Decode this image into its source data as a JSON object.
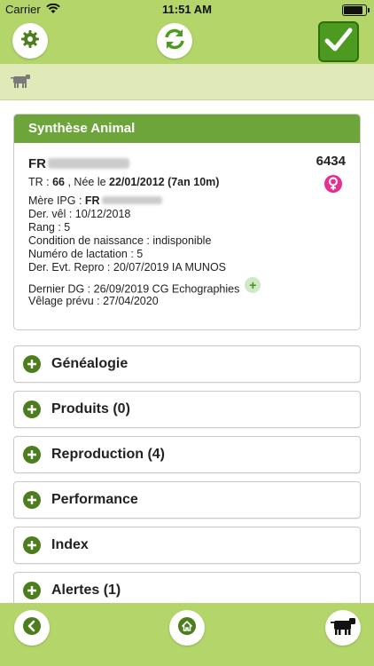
{
  "status_bar": {
    "carrier": "Carrier",
    "time": "11:51 AM"
  },
  "toolbar": {
    "settings_icon": "gear-icon",
    "refresh_icon": "refresh-icon",
    "confirm_icon": "checkmark-icon"
  },
  "synthese": {
    "title": "Synthèse Animal",
    "id_prefix": "FR",
    "number": "6434",
    "tr_label": "TR : ",
    "tr_value": "66",
    "birth_label": " , Née le ",
    "birth_value": "22/01/2012 (7an 10m)",
    "mother_label": "Mère IPG : ",
    "mother_prefix": "FR",
    "lines": [
      "Der. vêl : 10/12/2018",
      "Rang : 5",
      "Condition de naissance : indisponible",
      "Numéro de lactation : 5",
      "Der. Evt. Repro : 20/07/2019 IA MUNOS"
    ],
    "dg_line": "Dernier DG : 26/09/2019 CG Echographies",
    "velage_line": "Vêlage prévu : 27/04/2020"
  },
  "sections": [
    {
      "label": "Généalogie"
    },
    {
      "label": "Produits (0)"
    },
    {
      "label": "Reproduction (4)"
    },
    {
      "label": "Performance"
    },
    {
      "label": "Index"
    },
    {
      "label": "Alertes (1)"
    }
  ],
  "colors": {
    "bar_green": "#b3d56a",
    "header_green": "#6ea53a",
    "dark_green": "#4c7e1e",
    "female_pink": "#e5308f"
  }
}
